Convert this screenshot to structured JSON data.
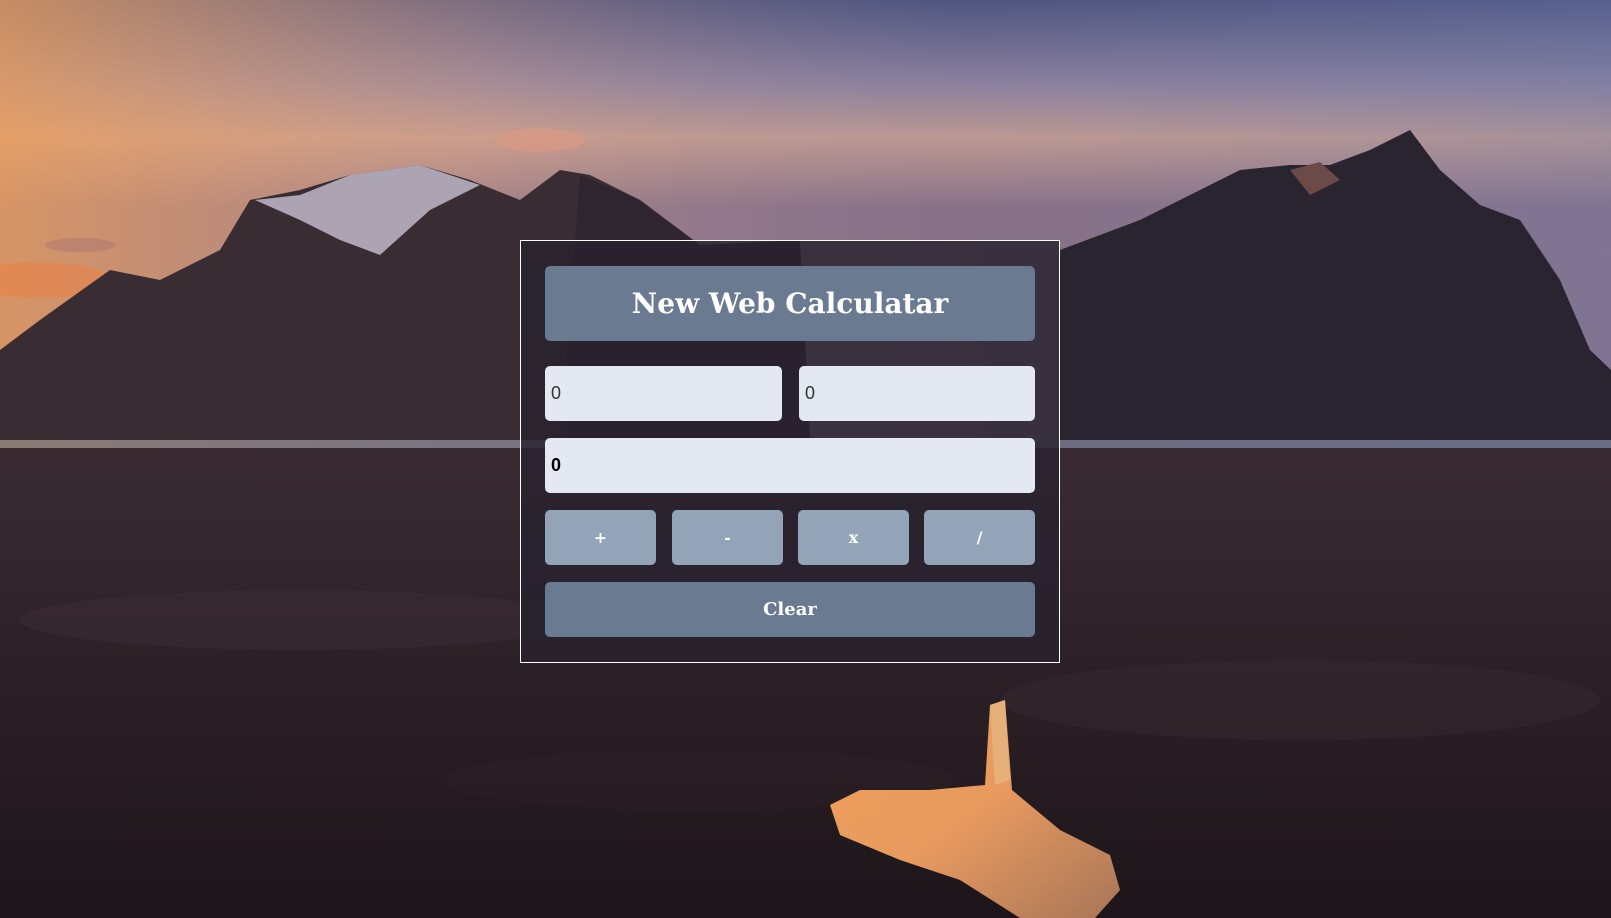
{
  "app": {
    "title": "New Web Calculatar"
  },
  "inputs": {
    "first_value": "0",
    "second_value": "0",
    "result_value": "0"
  },
  "operations": [
    {
      "label": "+"
    },
    {
      "label": "-"
    },
    {
      "label": "x"
    },
    {
      "label": "/"
    }
  ],
  "clear_label": "Clear",
  "colors": {
    "title_bar": "#697a91",
    "input_bg": "#e3e8f2",
    "op_button": "#94a4b8",
    "clear_button": "#697a91",
    "panel_border": "#ffffff"
  }
}
